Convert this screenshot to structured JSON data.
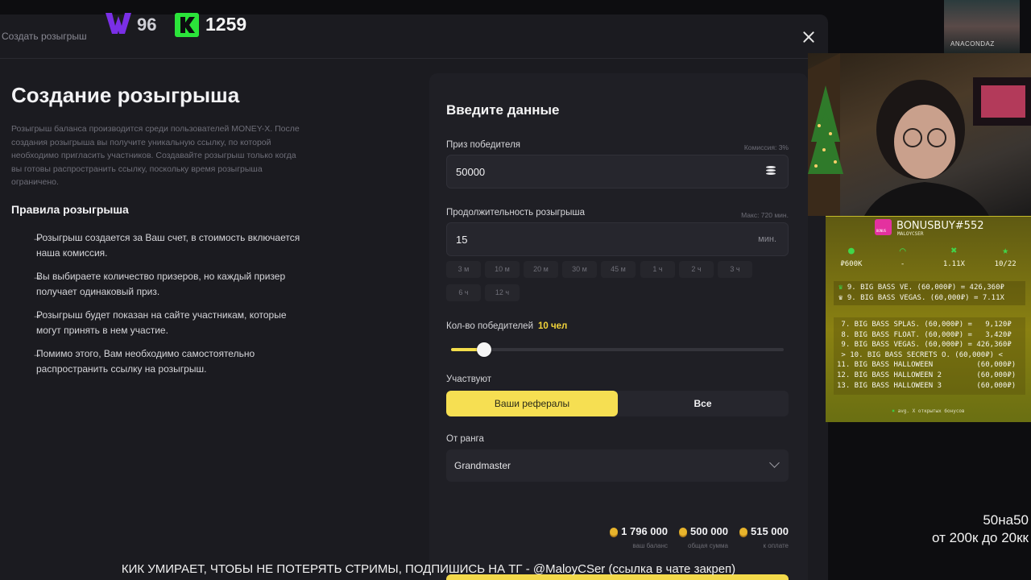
{
  "stream_overlay": {
    "w_count": "96",
    "k_count": "1259",
    "right_text_line1": "50на50",
    "right_text_line2": "от 200к до 20кк",
    "ticker": "КИК УМИРАЕТ, ЧТОБЫ НЕ ПОТЕРЯТЬ СТРИМЫ, ПОДПИШИСЬ НА ТГ - @MaloyCSer (ссылка в чате закреп)",
    "cam_art_text": "ANACONDAZ"
  },
  "modal": {
    "header_title": "Создать розыгрыш",
    "title": "Создание розыгрыша",
    "intro": "Розыгрыш баланса производится среди пользователей MONEY-X. После создания розыгрыша вы получите уникальную ссылку, по которой необходимо пригласить участников. Создавайте розыгрыш только когда вы готовы распространить ссылку, поскольку время розыгрыша ограничено.",
    "rules_title": "Правила розыгрыша",
    "rules": [
      "Розыгрыш создается за Ваш счет, в стоимость включается наша комиссия.",
      "Вы выбираете количество призеров, но каждый призер получает одинаковый приз.",
      "Розыгрыш будет показан на сайте участникам, которые могут принять в нем участие.",
      "Помимо этого, Вам необходимо самостоятельно распространить ссылку на розыгрыш."
    ]
  },
  "form": {
    "title": "Введите данные",
    "prize_label": "Приз победителя",
    "prize_hint": "Комиссия: 3%",
    "prize_value": "50000",
    "duration_label": "Продолжительность розыгрыша",
    "duration_hint": "Макс: 720 мин.",
    "duration_value": "15",
    "duration_unit": "мин.",
    "duration_presets": [
      "3 м",
      "10 м",
      "20 м",
      "30 м",
      "45 м",
      "1 ч",
      "2 ч",
      "3 ч",
      "6 ч",
      "12 ч"
    ],
    "winners_label": "Кол-во победителей",
    "winners_value": "10 чел",
    "winners_slider_fraction": 0.1,
    "participants_label": "Участвуют",
    "participants_options": [
      "Ваши рефералы",
      "Все"
    ],
    "participants_selected": "Ваши рефералы",
    "rank_label": "От ранга",
    "rank_value": "Grandmaster",
    "stats": [
      {
        "value": "1 796 000",
        "label": "ваш баланс"
      },
      {
        "value": "500 000",
        "label": "общая сумма"
      },
      {
        "value": "515 000",
        "label": "к оплате"
      }
    ],
    "accent_color": "#f6df52"
  },
  "bonus_widget": {
    "title": "BONUSBUY#552",
    "subtitle": "MALOYCSER",
    "gift_badge": "BONUS",
    "stats": [
      {
        "icon": "green-dot-icon",
        "text": "₽600K"
      },
      {
        "icon": "headphones-icon",
        "text": "-"
      },
      {
        "icon": "cross-icon",
        "text": "1.11X"
      },
      {
        "icon": "star-icon",
        "text": "10/22"
      }
    ],
    "top": [
      "9. BIG BASS VE. (60,000₽) = 426,360₽",
      "9. BIG BASS VEGAS. (60,000₽) = 7.11X"
    ],
    "list": [
      " 7. BIG BASS SPLAS. (60,000₽) =   9,120₽",
      " 8. BIG BASS FLOAT. (60,000₽) =   3,420₽",
      " 9. BIG BASS VEGAS. (60,000₽) = 426,360₽",
      " > 10. BIG BASS SECRETS O. (60,000₽) <",
      "11. BIG BASS HALLOWEEN          (60,000₽)",
      "12. BIG BASS HALLOWEEN 2        (60,000₽)",
      "13. BIG BASS HALLOWEEN 3        (60,000₽)"
    ],
    "footer": "avg. X открытых бонусов"
  }
}
